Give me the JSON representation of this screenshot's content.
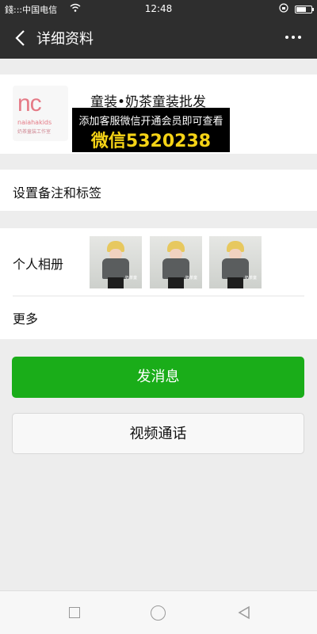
{
  "status_bar": {
    "left": "錢:::中国电信",
    "time": "12:48"
  },
  "nav": {
    "title": "详细资料",
    "back_icon": "chevron-left-icon",
    "more_icon": "more-dots-icon"
  },
  "profile": {
    "name": "童装•奶茶童装批发",
    "logo": {
      "big": "nc",
      "line1": "naiahakids",
      "line2": "奶茶童装工作室"
    },
    "promo_line1": "添加客服微信开通会员即可查看",
    "promo_line2": "微信5320238"
  },
  "remark": {
    "label": "设置备注和标签"
  },
  "album": {
    "label": "个人相册",
    "photo_tag": "奶茶童"
  },
  "more": {
    "label": "更多"
  },
  "actions": {
    "send_label": "发消息",
    "video_label": "视频通话"
  },
  "colors": {
    "accent_green": "#1aad19",
    "header_dark": "#2e2e2e",
    "promo_yellow": "#f5d316"
  }
}
